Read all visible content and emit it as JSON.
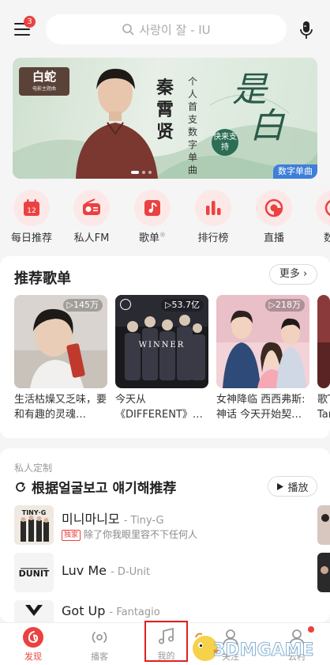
{
  "topbar": {
    "menu_badge": "3",
    "search_placeholder": "사랑이 잘 - IU"
  },
  "banner": {
    "logo_text": "白蛇",
    "logo_sub": "电影主题曲",
    "singer": "秦霄贤",
    "tagline": "个人首支数字单曲",
    "big_title": "是",
    "big_title_2": "白",
    "stamp": "快来支持",
    "tag": "数字单曲"
  },
  "quick_links": [
    {
      "label": "每日推荐",
      "icon": "calendar-icon",
      "date": "12"
    },
    {
      "label": "私人FM",
      "icon": "radio-icon"
    },
    {
      "label": "歌单",
      "icon": "playlist-icon",
      "mark": "®"
    },
    {
      "label": "排行榜",
      "icon": "chart-icon"
    },
    {
      "label": "直播",
      "icon": "live-icon"
    },
    {
      "label": "数字",
      "icon": "album-icon"
    }
  ],
  "recommended": {
    "title": "推荐歌单",
    "more_label": "更多",
    "playlists": [
      {
        "count": "▷145万",
        "title": "生活枯燥又乏味，要和有趣的灵魂…"
      },
      {
        "count": "▷53.7亿",
        "title": "今天从《DIFFERENT》…"
      },
      {
        "count": "▷218万",
        "title": "女神降临 西西弗斯:神话 今天开始契…"
      },
      {
        "title": "歌T Tar"
      }
    ]
  },
  "personal": {
    "eyebrow": "私人定制",
    "title": "根据얼굴보고 얘기해推荐",
    "play_label": "播放",
    "songs": [
      {
        "name": "미니마니모",
        "artist": "- Tiny-G",
        "badge": "独家",
        "sub": "除了你我眼里容不下任何人",
        "cover_text": "TINY·G"
      },
      {
        "name": "Luv Me",
        "artist": "- D-Unit",
        "badge": "",
        "sub": "",
        "cover_text": "DUNIT"
      },
      {
        "name": "Got Up",
        "artist": "- Fantagio",
        "badge": "",
        "sub": "",
        "cover_text": ""
      }
    ]
  },
  "tabbar": {
    "tabs": [
      {
        "label": "发现",
        "icon": "netease-logo-icon"
      },
      {
        "label": "播客",
        "icon": "podcast-icon"
      },
      {
        "label": "我的",
        "icon": "music-note-icon"
      },
      {
        "label": "关注",
        "icon": "follow-icon"
      },
      {
        "label": "云村",
        "icon": "cloud-village-icon"
      }
    ]
  },
  "watermark": {
    "text": "3DMGAME"
  },
  "colors": {
    "accent": "#ec4141",
    "highlight_box": "#e02020",
    "tag_blue": "#3d7fd9"
  }
}
